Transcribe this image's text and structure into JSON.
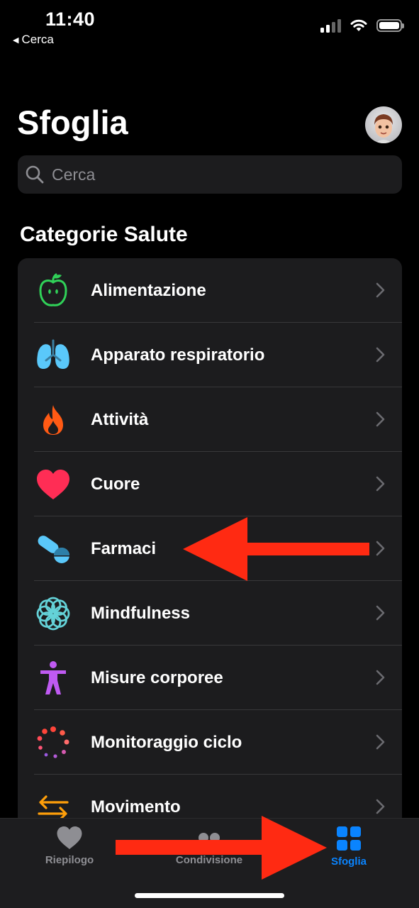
{
  "status_bar": {
    "time": "11:40",
    "back_label": "Cerca"
  },
  "header": {
    "title": "Sfoglia",
    "avatar_icon": "memoji-avatar"
  },
  "search": {
    "placeholder": "Cerca",
    "icon": "search-icon"
  },
  "categories": {
    "section_title": "Categorie Salute",
    "items": [
      {
        "label": "Alimentazione",
        "icon": "apple-icon",
        "color": "#30d158"
      },
      {
        "label": "Apparato respiratorio",
        "icon": "lungs-icon",
        "color": "#5ac8fa"
      },
      {
        "label": "Attività",
        "icon": "flame-icon",
        "color": "#ff6b1a"
      },
      {
        "label": "Cuore",
        "icon": "heart-icon",
        "color": "#ff2d55"
      },
      {
        "label": "Farmaci",
        "icon": "pills-icon",
        "color": "#5ac8fa"
      },
      {
        "label": "Mindfulness",
        "icon": "flower-icon",
        "color": "#64d2d8"
      },
      {
        "label": "Misure corporee",
        "icon": "figure-icon",
        "color": "#bf5af2"
      },
      {
        "label": "Monitoraggio ciclo",
        "icon": "cycle-dots-icon",
        "color": "#ff453a"
      },
      {
        "label": "Movimento",
        "icon": "arrows-icon",
        "color": "#ff9f0a"
      }
    ]
  },
  "tabbar": {
    "tabs": [
      {
        "label": "Riepilogo",
        "icon": "heart-tab-icon",
        "active": false
      },
      {
        "label": "Condivisione",
        "icon": "people-tab-icon",
        "active": false
      },
      {
        "label": "Sfoglia",
        "icon": "grid-tab-icon",
        "active": true
      }
    ]
  },
  "colors": {
    "accent": "#0a84ff",
    "annotation_arrow": "#ff2a12",
    "background": "#000000",
    "card": "#1c1c1e"
  }
}
